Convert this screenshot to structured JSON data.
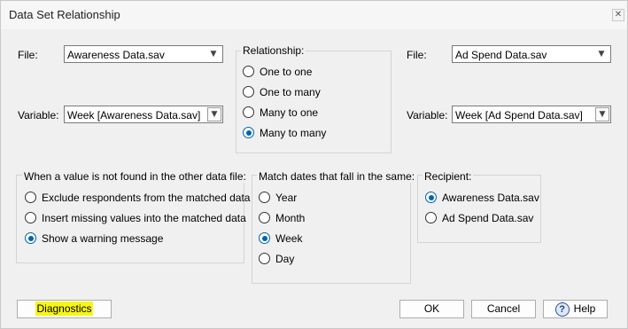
{
  "window": {
    "title": "Data Set Relationship",
    "close_glyph": "✕"
  },
  "left": {
    "file_label": "File:",
    "file_value": "Awareness Data.sav",
    "variable_label": "Variable:",
    "variable_value": "Week [Awareness Data.sav]"
  },
  "right": {
    "file_label": "File:",
    "file_value": "Ad Spend Data.sav",
    "variable_label": "Variable:",
    "variable_value": "Week [Ad Spend Data.sav]"
  },
  "relationship": {
    "title": "Relationship:",
    "options": [
      "One to one",
      "One to many",
      "Many to one",
      "Many to many"
    ],
    "selected": "Many to many"
  },
  "not_found": {
    "title": "When a value is not found in the other data file:",
    "options": [
      "Exclude respondents from the matched data",
      "Insert missing values into the matched data",
      "Show a warning message"
    ],
    "selected": "Show a warning message"
  },
  "match_dates": {
    "title": "Match dates that fall in the same:",
    "options": [
      "Year",
      "Month",
      "Week",
      "Day"
    ],
    "selected": "Week"
  },
  "recipient": {
    "title": "Recipient:",
    "options": [
      "Awareness Data.sav",
      "Ad Spend Data.sav"
    ],
    "selected": "Awareness Data.sav"
  },
  "buttons": {
    "diagnostics": "Diagnostics",
    "ok": "OK",
    "cancel": "Cancel",
    "help": "Help",
    "help_icon_glyph": "?"
  },
  "colors": {
    "accent": "#0063b1",
    "highlight": "#f6f51a"
  }
}
